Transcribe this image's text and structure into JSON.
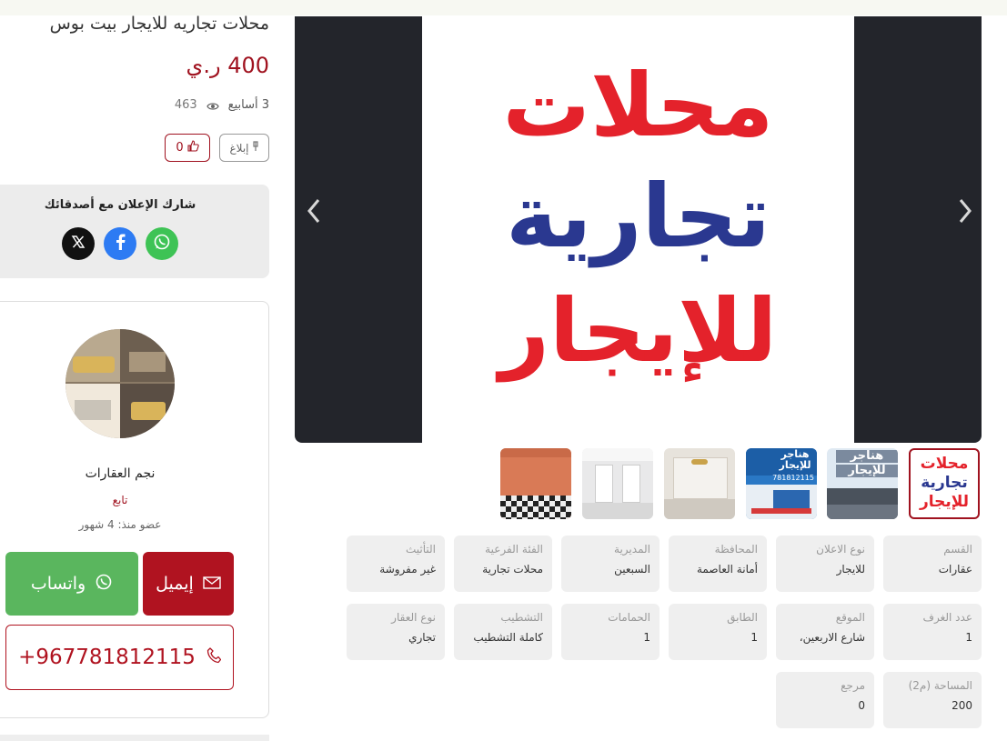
{
  "listing": {
    "title": "محلات تجاريه للايجار بيت بوس",
    "price": "400 ر.ي",
    "posted": "3 أسابيع",
    "views": "463",
    "report_label": "إبلاغ",
    "likes": "0"
  },
  "share": {
    "title": "شارك الإعلان مع أصدقائك",
    "networks": [
      "x-icon",
      "facebook-icon",
      "whatsapp-icon"
    ]
  },
  "seller": {
    "name": "نجم العقارات",
    "follow_label": "تابع",
    "member_since": "عضو منذ: 4 شهور",
    "email_label": "إيميل",
    "whatsapp_label": "واتساب",
    "phone": "+967781812115"
  },
  "gallery": {
    "main_text": [
      "محلات",
      "تجارية",
      "للإيجار"
    ],
    "thumb_text_1": [
      "محلات",
      "تجارية",
      "للإيجار"
    ],
    "thumb_text_2": [
      "هناجر",
      "للإيجار"
    ],
    "thumb_text_3": [
      "هناجر",
      "للإيجار"
    ],
    "thumb_phone": "781812115"
  },
  "details": [
    {
      "label": "القسم",
      "value": "عقارات"
    },
    {
      "label": "نوع الاعلان",
      "value": "للايجار"
    },
    {
      "label": "المحافظة",
      "value": "أمانة العاصمة"
    },
    {
      "label": "المديرية",
      "value": "السبعين"
    },
    {
      "label": "الفئة الفرعية",
      "value": "محلات تجارية"
    },
    {
      "label": "التأثيث",
      "value": "غير مفروشة"
    },
    {
      "label": "عدد الغرف",
      "value": "1"
    },
    {
      "label": "الموقع",
      "value": "شارع الاربعين،"
    },
    {
      "label": "الطابق",
      "value": "1"
    },
    {
      "label": "الحمامات",
      "value": "1"
    },
    {
      "label": "التشطيب",
      "value": "كاملة التشطيب"
    },
    {
      "label": "نوع العقار",
      "value": "تجاري"
    },
    {
      "label": "المساحة (م2)",
      "value": "200"
    },
    {
      "label": "مرجع",
      "value": "0"
    }
  ],
  "colors": {
    "brand_red": "#a0121f",
    "whatsapp_green": "#5ab65e",
    "facebook_blue": "#2d7bf3",
    "gallery_bg": "#23252b"
  }
}
